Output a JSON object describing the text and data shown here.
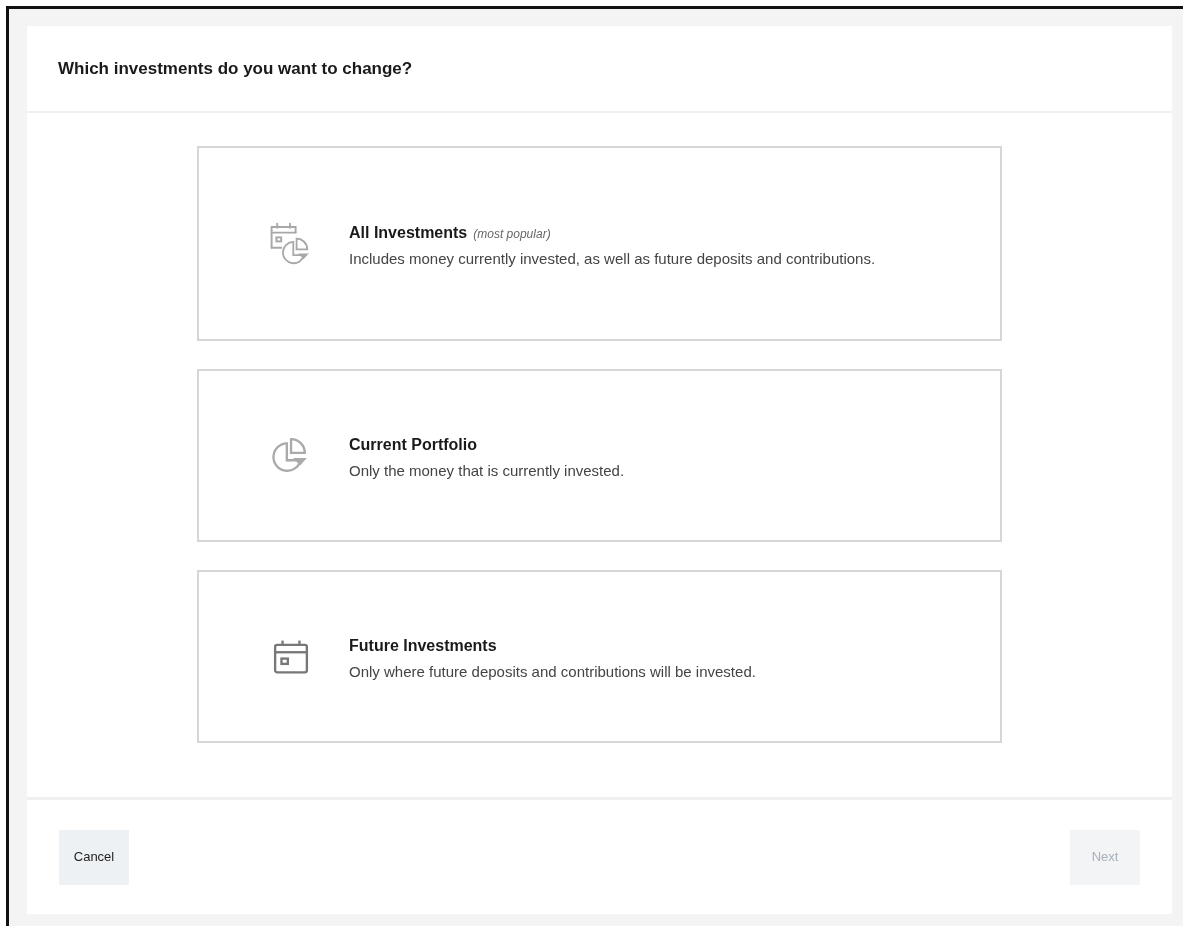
{
  "title": "Which investments do you want to change?",
  "options": [
    {
      "kind": "calendar-pie",
      "title": "All Investments",
      "note": "(most popular)",
      "description": "Includes money currently invested, as well as future deposits and contributions."
    },
    {
      "kind": "pie",
      "title": "Current Portfolio",
      "description": "Only the money that is currently invested."
    },
    {
      "kind": "calendar",
      "title": "Future Investments",
      "description": "Only where future deposits and contributions will be invested."
    }
  ],
  "buttons": [
    {
      "label": "Cancel",
      "disabled": false
    },
    {
      "label": "Next",
      "disabled": true
    }
  ]
}
